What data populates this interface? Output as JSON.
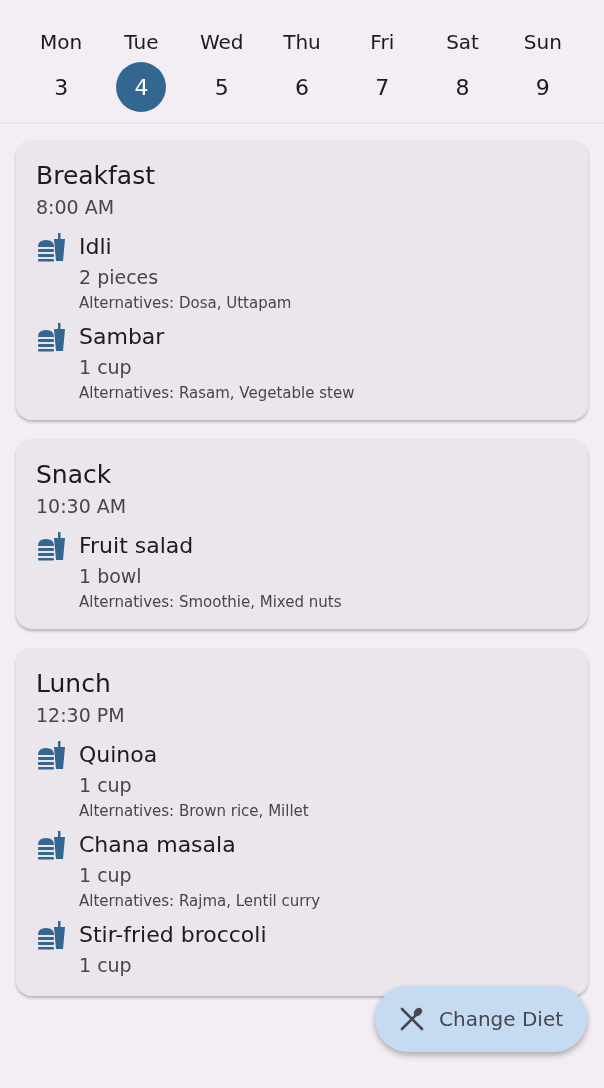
{
  "week": [
    {
      "day": "Mon",
      "date": "3",
      "selected": false
    },
    {
      "day": "Tue",
      "date": "4",
      "selected": true
    },
    {
      "day": "Wed",
      "date": "5",
      "selected": false
    },
    {
      "day": "Thu",
      "date": "6",
      "selected": false
    },
    {
      "day": "Fri",
      "date": "7",
      "selected": false
    },
    {
      "day": "Sat",
      "date": "8",
      "selected": false
    },
    {
      "day": "Sun",
      "date": "9",
      "selected": false
    }
  ],
  "meals": [
    {
      "title": "Breakfast",
      "time": "8:00 AM",
      "items": [
        {
          "name": "Idli",
          "amount": "2 pieces",
          "alternatives": "Alternatives: Dosa, Uttapam"
        },
        {
          "name": "Sambar",
          "amount": "1 cup",
          "alternatives": "Alternatives: Rasam, Vegetable stew"
        }
      ]
    },
    {
      "title": "Snack",
      "time": "10:30 AM",
      "items": [
        {
          "name": "Fruit salad",
          "amount": "1 bowl",
          "alternatives": "Alternatives: Smoothie, Mixed nuts"
        }
      ]
    },
    {
      "title": "Lunch",
      "time": "12:30 PM",
      "items": [
        {
          "name": "Quinoa",
          "amount": "1 cup",
          "alternatives": "Alternatives: Brown rice, Millet"
        },
        {
          "name": "Chana masala",
          "amount": "1 cup",
          "alternatives": "Alternatives: Rajma, Lentil curry"
        },
        {
          "name": "Stir-fried broccoli",
          "amount": "1 cup"
        }
      ]
    }
  ],
  "fab": {
    "label": "Change Diet"
  }
}
